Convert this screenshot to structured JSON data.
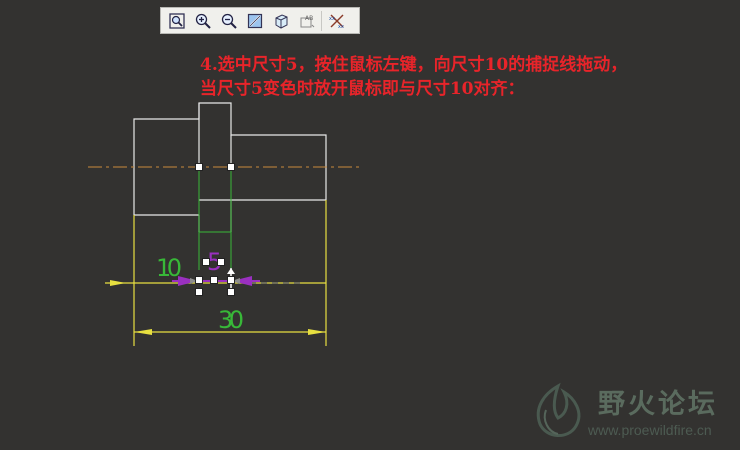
{
  "toolbar": {
    "buttons": [
      {
        "name": "zoom-fit-icon"
      },
      {
        "name": "zoom-in-icon"
      },
      {
        "name": "zoom-out-icon"
      },
      {
        "name": "repaint-icon"
      },
      {
        "name": "display-style-icon"
      },
      {
        "name": "annotation-display-icon"
      },
      {
        "name": "datum-display-icon"
      }
    ]
  },
  "instructions": {
    "line1": "4.选中尺寸5，按住鼠标左键，向尺寸10的捕捉线拖动，",
    "line2": "当尺寸5变色时放开鼠标即与尺寸10对齐："
  },
  "dimensions": {
    "left_dim": "10",
    "center_dim": "5",
    "bottom_dim": "30"
  },
  "colors": {
    "background": "#333230",
    "geometry": "#e8e8e8",
    "centerline": "#c88a3c",
    "section_lines": "#e8e040",
    "dim_text": "#38b838",
    "selected_dim": "#9a30c0",
    "instruction_text": "#e8242a"
  },
  "watermark": {
    "name": "野火论坛",
    "url": "www.proewildfire.cn"
  }
}
